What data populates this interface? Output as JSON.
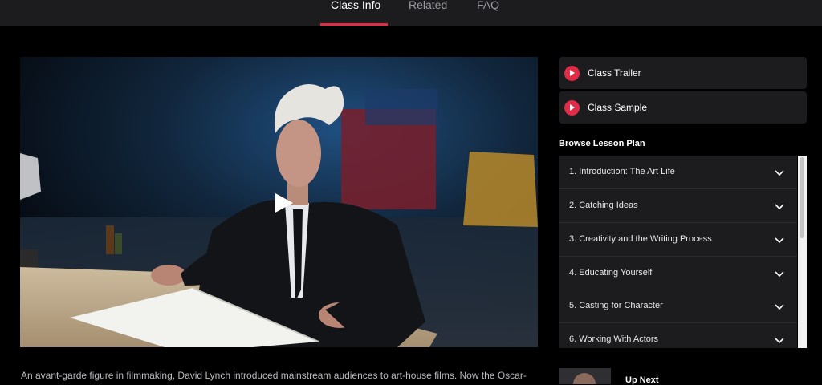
{
  "nav": {
    "tabs": [
      {
        "label": "Class Info",
        "active": true
      },
      {
        "label": "Related",
        "active": false
      },
      {
        "label": "FAQ",
        "active": false
      }
    ]
  },
  "video": {
    "play_icon": "play-icon"
  },
  "sidebar": {
    "buttons": [
      {
        "label": "Class Trailer",
        "icon": "play-circle-icon"
      },
      {
        "label": "Class Sample",
        "icon": "play-circle-icon"
      }
    ],
    "browse_title": "Browse Lesson Plan",
    "lessons": [
      "1. Introduction: The Art Life",
      "2. Catching Ideas",
      "3. Creativity and the Writing Process",
      "4. Educating Yourself",
      "5. Casting for Character",
      "6. Working With Actors"
    ],
    "up_next": "Up Next"
  },
  "description": "An avant-garde figure in filmmaking, David Lynch introduced mainstream audiences to art-house films. Now the Oscar-",
  "colors": {
    "accent": "#e02d47",
    "panel": "#1c1c1f",
    "background": "#000000"
  }
}
